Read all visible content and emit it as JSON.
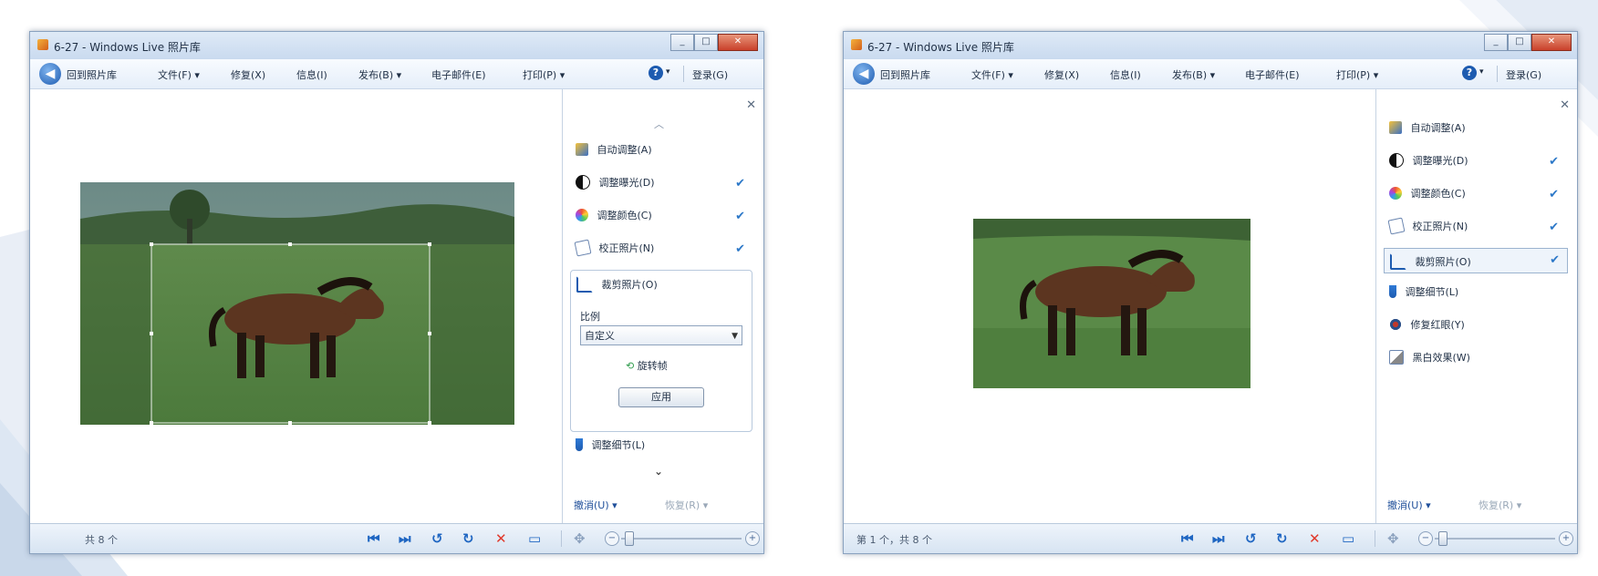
{
  "left_window": {
    "title": "6-27 - Windows Live 照片库",
    "menu": [
      "回到照片库",
      "文件(F) ▾",
      "修复(X)",
      "信息(I)",
      "发布(B) ▾",
      "电子邮件(E)",
      "打印(P) ▾"
    ],
    "help_label": "?",
    "login_label": "登录(G)",
    "pane_items": [
      {
        "label": "自动调整(A)",
        "icon": "magic-wand-icon",
        "checked": false
      },
      {
        "label": "调整曝光(D)",
        "icon": "exposure-icon",
        "checked": true
      },
      {
        "label": "调整颜色(C)",
        "icon": "color-wheel-icon",
        "checked": true
      },
      {
        "label": "校正照片(N)",
        "icon": "straighten-icon",
        "checked": true
      },
      {
        "label": "裁剪照片(O)",
        "icon": "crop-icon",
        "checked": false
      }
    ],
    "crop": {
      "ratio_label": "比例",
      "ratio_value": "自定义",
      "rotate_frame_label": "旋转帧",
      "apply_label": "应用"
    },
    "detail_item": {
      "label": "调整细节(L)",
      "icon": "detail-icon"
    },
    "undo_label": "撤消(U) ▾",
    "redo_label": "恢复(R) ▾",
    "status_text": "共 8 个"
  },
  "right_window": {
    "title": "6-27 - Windows Live 照片库",
    "menu": [
      "回到照片库",
      "文件(F) ▾",
      "修复(X)",
      "信息(I)",
      "发布(B) ▾",
      "电子邮件(E)",
      "打印(P) ▾"
    ],
    "help_label": "?",
    "login_label": "登录(G)",
    "pane_items": [
      {
        "label": "自动调整(A)",
        "icon": "magic-wand-icon",
        "checked": false
      },
      {
        "label": "调整曝光(D)",
        "icon": "exposure-icon",
        "checked": true
      },
      {
        "label": "调整颜色(C)",
        "icon": "color-wheel-icon",
        "checked": true
      },
      {
        "label": "校正照片(N)",
        "icon": "straighten-icon",
        "checked": true
      },
      {
        "label": "裁剪照片(O)",
        "icon": "crop-icon",
        "checked": true
      },
      {
        "label": "调整细节(L)",
        "icon": "detail-icon",
        "checked": false
      },
      {
        "label": "修复红眼(Y)",
        "icon": "red-eye-icon",
        "checked": false
      },
      {
        "label": "黑白效果(W)",
        "icon": "bw-effect-icon",
        "checked": false
      }
    ],
    "undo_label": "撤消(U) ▾",
    "redo_label": "恢复(R) ▾",
    "status_text": "第 1 个，共 8 个"
  },
  "icons": {
    "back": "back-arrow-icon",
    "close": "close-icon",
    "check": "checkmark-icon",
    "first": "first-photo-icon",
    "last": "last-photo-icon",
    "rotate_left": "rotate-left-icon",
    "rotate_right": "rotate-right-icon",
    "delete": "delete-icon",
    "slideshow": "slideshow-icon"
  },
  "colors": {
    "accent": "#1d5bb0",
    "check": "#2c78c8",
    "delete": "#e0392b",
    "title_bar": "#c9daef"
  }
}
